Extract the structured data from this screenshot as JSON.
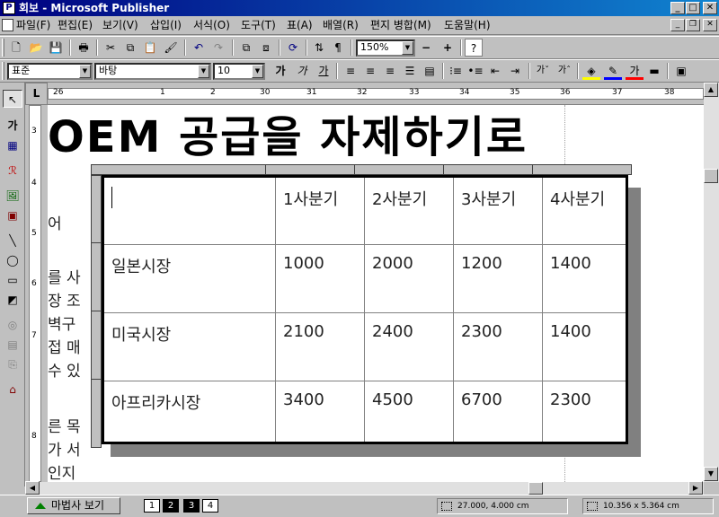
{
  "window": {
    "title": "회보 - Microsoft Publisher",
    "app_icon_letter": "P",
    "minimize": "_",
    "maximize": "□",
    "close": "✕"
  },
  "menu": {
    "items": [
      "파일(F)",
      "편집(E)",
      "보기(V)",
      "삽입(I)",
      "서식(O)",
      "도구(T)",
      "표(A)",
      "배열(R)",
      "편지 병합(M)",
      "도움말(H)"
    ],
    "mdi_min": "_",
    "mdi_restore": "❐",
    "mdi_close": "✕"
  },
  "toolbar": {
    "zoom": "150%",
    "zoom_out": "−",
    "zoom_in": "+",
    "style_value": "표준",
    "font_value": "바탕",
    "size_value": "10",
    "bold_label": "가",
    "italic_label": "가",
    "underline_label": "가"
  },
  "ruler": {
    "corner_label": "L",
    "h_numbers": [
      "26",
      "1",
      "2",
      "30",
      "31",
      "32",
      "33",
      "34",
      "35",
      "36",
      "37",
      "38"
    ],
    "v_numbers": [
      "3",
      "4",
      "5",
      "6",
      "7",
      "8"
    ]
  },
  "document": {
    "heading": "OEM 공급을 자제하기로",
    "side_text": [
      "어",
      "를 사",
      "장 조",
      "벽구",
      "접 매",
      "수 있",
      "",
      "른 목",
      "가 서",
      "인지"
    ]
  },
  "table": {
    "header": [
      "",
      "1사분기",
      "2사분기",
      "3사분기",
      "4사분기"
    ],
    "rows": [
      [
        "일본시장",
        "1000",
        "2000",
        "1200",
        "1400"
      ],
      [
        "미국시장",
        "2100",
        "2400",
        "2300",
        "1400"
      ],
      [
        "아프리카시장",
        "3400",
        "4500",
        "6700",
        "2300"
      ]
    ]
  },
  "statusbar": {
    "wizard_label": "마법사 보기",
    "pages": [
      "1",
      "2",
      "3",
      "4"
    ],
    "position": "27.000, 4.000 cm",
    "size": "10.356 x   5.364 cm"
  }
}
